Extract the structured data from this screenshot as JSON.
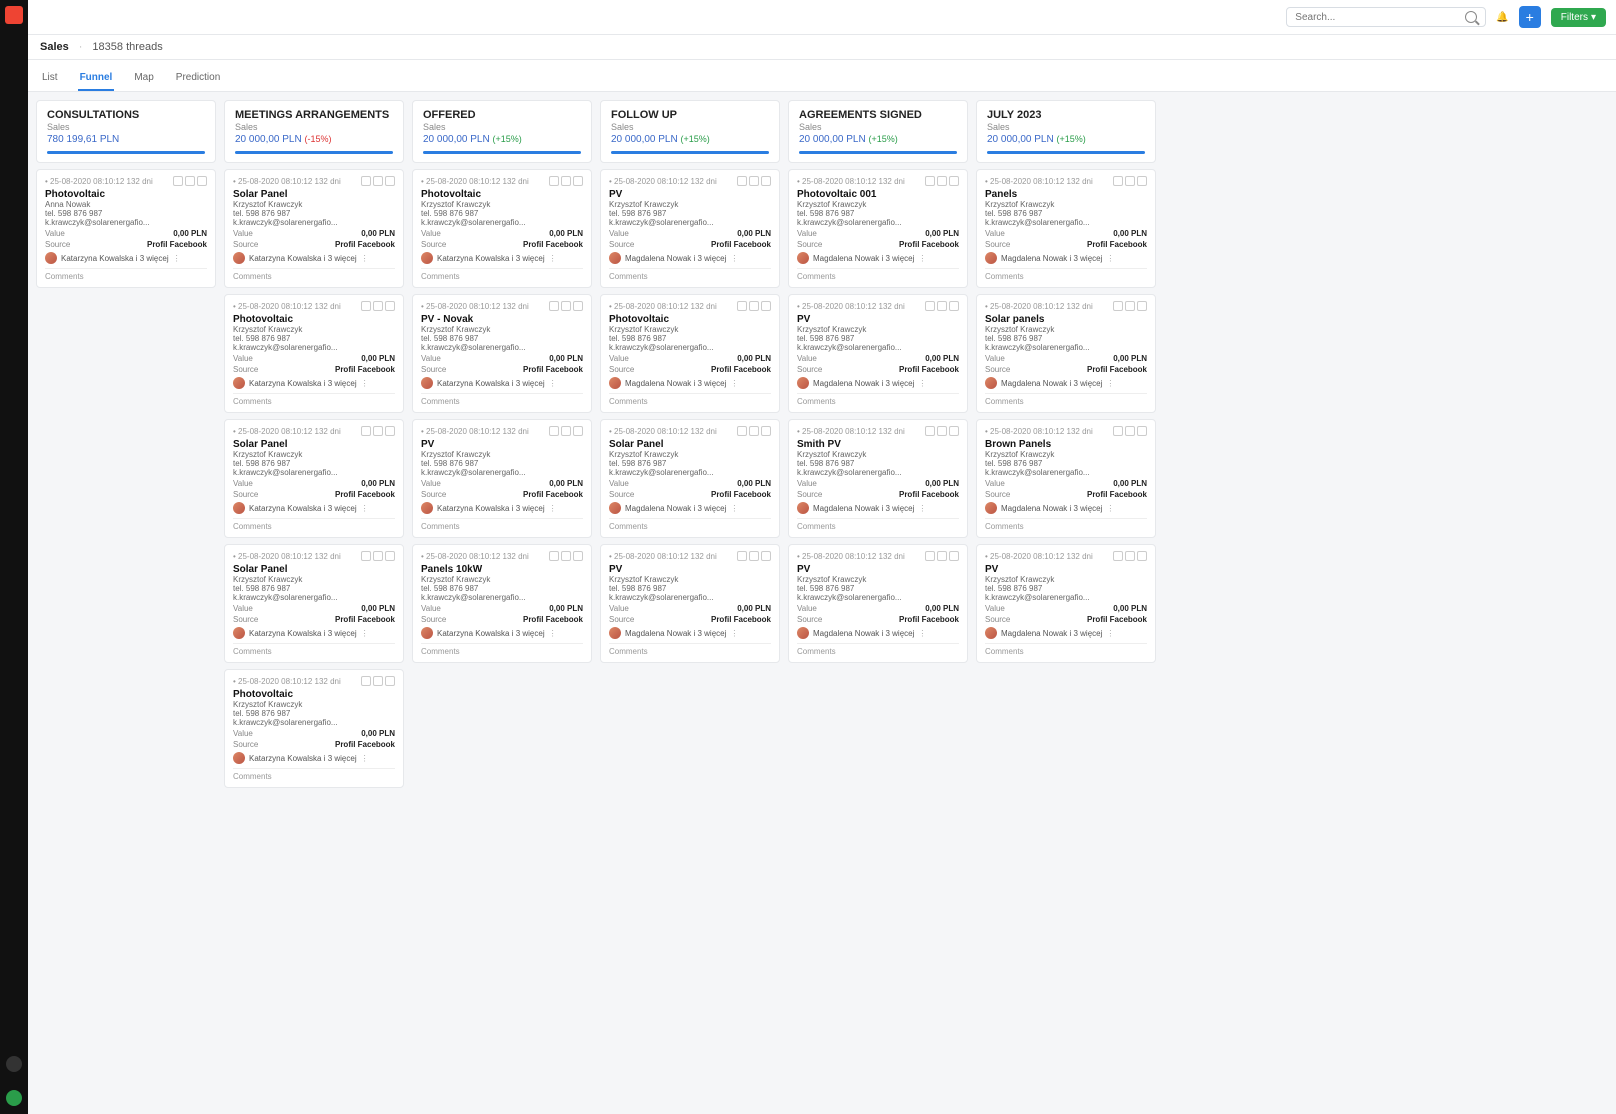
{
  "header": {
    "search_placeholder": "Search...",
    "add_label": "+",
    "filters_label": "Filters"
  },
  "breadcrumb": {
    "section": "Sales",
    "count": "18358 threads"
  },
  "tabs": [
    {
      "label": "List",
      "active": false
    },
    {
      "label": "Funnel",
      "active": true
    },
    {
      "label": "Map",
      "active": false
    },
    {
      "label": "Prediction",
      "active": false
    }
  ],
  "card_template": {
    "date": "25-08-2020  08:10:12  132 dni",
    "value_label": "Value",
    "value": "0,00 PLN",
    "source_label": "Source",
    "source": "Profil Facebook",
    "assignee_suffix": "i 3 więcej",
    "comments_label": "Comments",
    "person1": {
      "name": "Anna Nowak",
      "tel": "tel. 598 876 987",
      "email": "k.krawczyk@solarenergafio..."
    },
    "person2": {
      "name": "Krzysztof Krawczyk",
      "tel": "tel. 598 876 987",
      "email": "k.krawczyk@solarenergafio..."
    },
    "assignee_k": "Katarzyna Kowalska",
    "assignee_m": "Magdalena Nowak"
  },
  "columns": [
    {
      "title": "CONSULTATIONS",
      "subtitle": "Sales",
      "amount": "780 199,61 PLN",
      "pct": "",
      "cards": [
        {
          "title": "Photovoltaic",
          "person": "person1",
          "assignee": "assignee_k"
        }
      ]
    },
    {
      "title": "MEETINGS ARRANGEMENTS",
      "subtitle": "Sales",
      "amount": "20 000,00 PLN",
      "pct": "(-15%)",
      "pct_class": "neg",
      "cards": [
        {
          "title": "Solar Panel",
          "person": "person2",
          "assignee": "assignee_k"
        },
        {
          "title": "Photovoltaic",
          "person": "person2",
          "assignee": "assignee_k"
        },
        {
          "title": "Solar Panel",
          "person": "person2",
          "assignee": "assignee_k"
        },
        {
          "title": "Solar Panel",
          "person": "person2",
          "assignee": "assignee_k"
        },
        {
          "title": "Photovoltaic",
          "person": "person2",
          "assignee": "assignee_k"
        }
      ]
    },
    {
      "title": "OFFERED",
      "subtitle": "Sales",
      "amount": "20 000,00 PLN",
      "pct": "(+15%)",
      "pct_class": "pos",
      "cards": [
        {
          "title": "Photovoltaic",
          "person": "person2",
          "assignee": "assignee_k"
        },
        {
          "title": "PV - Novak",
          "person": "person2",
          "assignee": "assignee_k"
        },
        {
          "title": "PV",
          "person": "person2",
          "assignee": "assignee_k"
        },
        {
          "title": "Panels 10kW",
          "person": "person2",
          "assignee": "assignee_k"
        }
      ]
    },
    {
      "title": "FOLLOW UP",
      "subtitle": "Sales",
      "amount": "20 000,00 PLN",
      "pct": "(+15%)",
      "pct_class": "pos",
      "cards": [
        {
          "title": "PV",
          "person": "person2",
          "assignee": "assignee_m"
        },
        {
          "title": "Photovoltaic",
          "person": "person2",
          "assignee": "assignee_m"
        },
        {
          "title": "Solar Panel",
          "person": "person2",
          "assignee": "assignee_m"
        },
        {
          "title": "PV",
          "person": "person2",
          "assignee": "assignee_m"
        }
      ]
    },
    {
      "title": "AGREEMENTS SIGNED",
      "subtitle": "Sales",
      "amount": "20 000,00 PLN",
      "pct": "(+15%)",
      "pct_class": "pos",
      "cards": [
        {
          "title": "Photovoltaic 001",
          "person": "person2",
          "assignee": "assignee_m"
        },
        {
          "title": "PV",
          "person": "person2",
          "assignee": "assignee_m"
        },
        {
          "title": "Smith PV",
          "person": "person2",
          "assignee": "assignee_m"
        },
        {
          "title": "PV",
          "person": "person2",
          "assignee": "assignee_m"
        }
      ]
    },
    {
      "title": "JULY 2023",
      "subtitle": "Sales",
      "amount": "20 000,00 PLN",
      "pct": "(+15%)",
      "pct_class": "pos",
      "cards": [
        {
          "title": "Panels",
          "person": "person2",
          "assignee": "assignee_m"
        },
        {
          "title": "Solar panels",
          "person": "person2",
          "assignee": "assignee_m"
        },
        {
          "title": "Brown Panels",
          "person": "person2",
          "assignee": "assignee_m"
        },
        {
          "title": "PV",
          "person": "person2",
          "assignee": "assignee_m"
        }
      ]
    }
  ]
}
